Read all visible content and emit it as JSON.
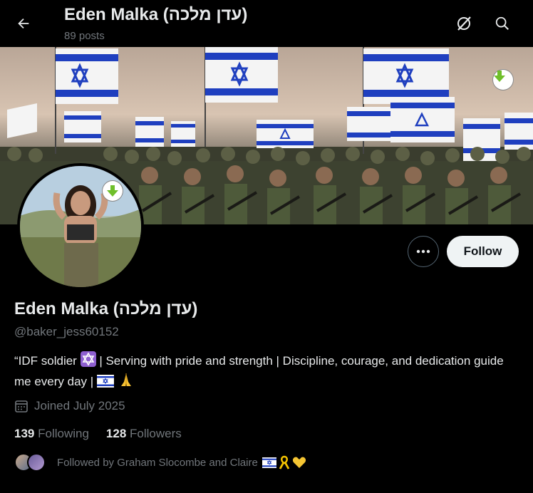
{
  "header": {
    "title": "Eden Malka (עדן מלכה)",
    "posts": "89 posts"
  },
  "profile": {
    "name": "Eden Malka (עדן מלכה)",
    "handle": "@baker_jess60152",
    "bio_part1": "“IDF soldier",
    "bio_part2": " | Serving with pride and strength | Discipline, courage, and dedication guide me every day |",
    "joined": "Joined July 2025",
    "following_count": "139",
    "following_label": "Following",
    "followers_count": "128",
    "followers_label": "Followers",
    "followed_by": "Followed by Graham Slocombe and Claire"
  },
  "actions": {
    "follow_label": "Follow"
  },
  "colors": {
    "background": "#000000",
    "text_primary": "#e7e9ea",
    "text_secondary": "#71767b",
    "follow_bg": "#eff3f4",
    "flag_blue": "#1f3fbf",
    "badge_green": "#6fbf2a"
  },
  "icons": [
    "back-arrow-icon",
    "grok-icon",
    "search-icon",
    "more-icon",
    "calendar-icon",
    "star-of-david-emoji",
    "israel-flag-emoji",
    "praying-hands-emoji",
    "yellow-ribbon-emoji",
    "yellow-heart-emoji",
    "download-badge-icon"
  ]
}
